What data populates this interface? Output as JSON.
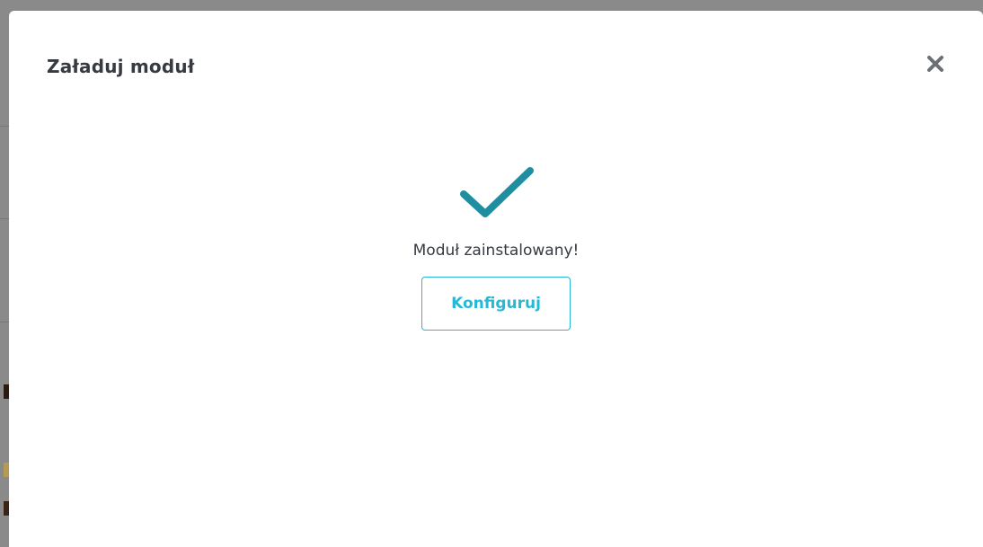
{
  "modal": {
    "title": "Załaduj moduł",
    "close_icon": "close-icon",
    "success_icon": "checkmark-icon",
    "status_text": "Moduł zainstalowany!",
    "configure_label": "Konfiguruj"
  },
  "colors": {
    "accent": "#25b9d7",
    "checkmark": "#1e8ea0",
    "title_text": "#363a41",
    "close_icon": "#6c6f74"
  }
}
